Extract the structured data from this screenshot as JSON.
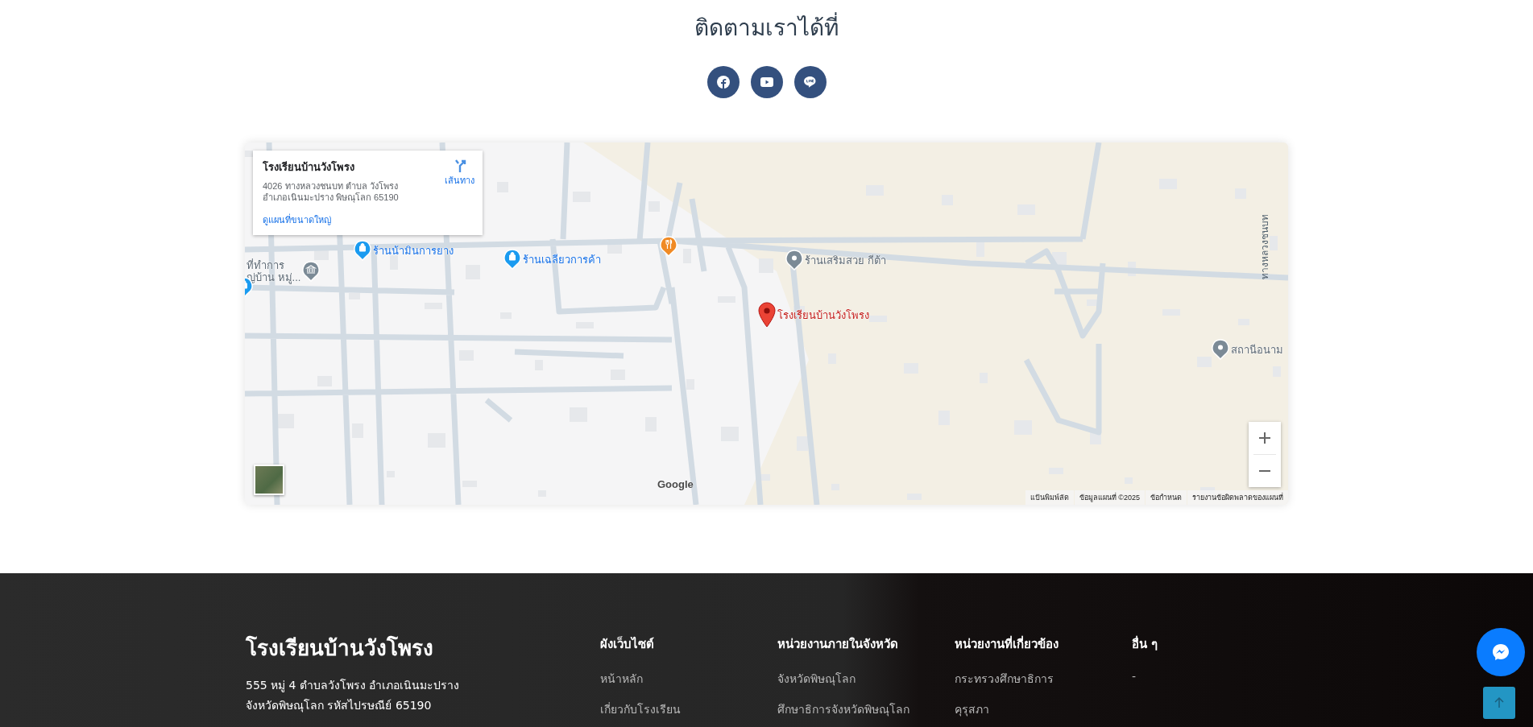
{
  "section_title": "ติดตามเราได้ที่",
  "social_links": [
    {
      "kind": "facebook"
    },
    {
      "kind": "youtube"
    },
    {
      "kind": "line"
    }
  ],
  "map": {
    "info_card": {
      "name": "โรงเรียนบ้านวังโพรง",
      "address_lines": [
        "4026 ทางหลวงชนบท ตำบล วังโพรง",
        "อำเภอเนินมะปราง พิษณุโลก 65190"
      ],
      "directions": "เส้นทาง",
      "larger_map_link": "ดูแผนที่ขนาดใหญ่"
    },
    "places": [
      {
        "kind": "shop",
        "lines": [
          "ร้านน้ามินการยาง"
        ]
      },
      {
        "kind": "shop",
        "lines": [
          "ร้านเฉลียวการค้า"
        ]
      },
      {
        "kind": "food"
      },
      {
        "kind": "poi",
        "lines": [
          "ร้านเสริมสวย กีต้า"
        ]
      },
      {
        "kind": "government",
        "lines": [
          "ที่ทำการ",
          "ญ่บ้าน หมู่..."
        ]
      },
      {
        "kind": "school",
        "lines": [
          "โรงเรียนบ้านวังโพรง"
        ]
      },
      {
        "kind": "poi",
        "lines": [
          "สถานีอนาม"
        ]
      },
      {
        "kind": "shop"
      }
    ],
    "road_label": "ทางหลวงชนบท",
    "logo": "Google",
    "attribution": [
      "แป้นพิมพ์ลัด",
      "ข้อมูลแผนที่ ©2025",
      "ข้อกำหนด",
      "รายงานข้อผิดพลาดของแผนที่"
    ]
  },
  "footer": {
    "school_name": "โรงเรียนบ้านวังโพรง",
    "address_lines": [
      "555 หมู่ 4 ตำบลวังโพรง อำเภอเนินมะปราง",
      "จังหวัดพิษณุโลก รหัสไปรษณีย์ 65190"
    ],
    "columns": [
      {
        "heading": "ผังเว็บไซต์",
        "links": [
          "หน้าหลัก",
          "เกี่ยวกับโรงเรียน"
        ]
      },
      {
        "heading": "หน่วยงานภายในจังหวัด",
        "links": [
          "จังหวัดพิษณุโลก",
          "ศึกษาธิการจังหวัดพิษณุโลก"
        ]
      },
      {
        "heading": "หน่วยงานที่เกี่ยวข้อง",
        "links": [
          "กระทรวงศึกษาธิการ",
          "คุรุสภา"
        ]
      },
      {
        "heading": "อื่น ๆ",
        "links": [
          "-"
        ]
      }
    ]
  },
  "floating_buttons": [
    {
      "kind": "messenger"
    },
    {
      "kind": "back_to_top"
    }
  ]
}
